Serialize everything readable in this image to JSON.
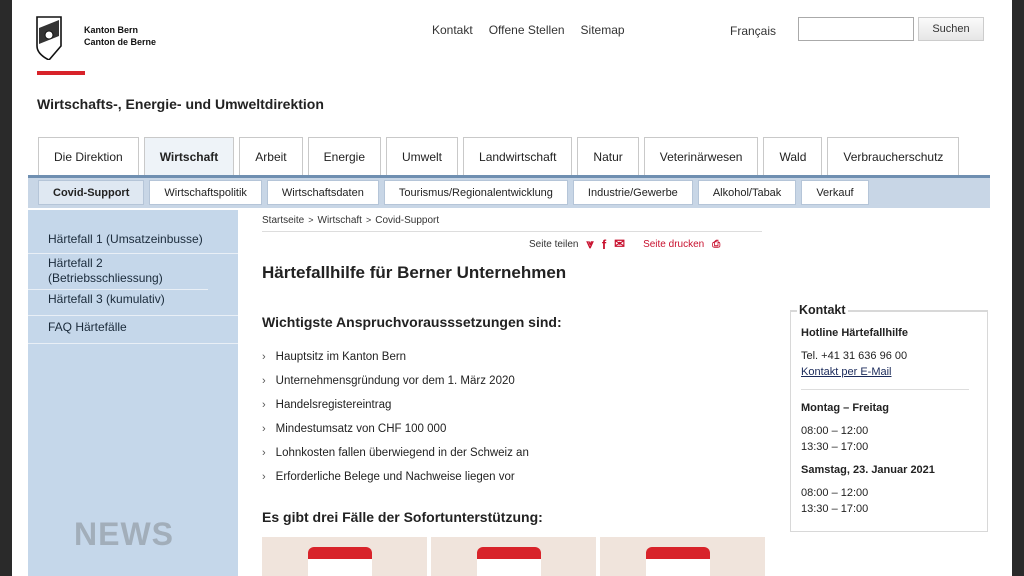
{
  "header": {
    "logo_line1": "Kanton Bern",
    "logo_line2": "Canton de Berne",
    "top_links": [
      "Kontakt",
      "Offene Stellen",
      "Sitemap"
    ],
    "language": "Français",
    "search_placeholder": "",
    "search_button": "Suchen"
  },
  "department_title": "Wirtschafts-, Energie- und Umweltdirektion",
  "main_tabs": [
    {
      "label": "Die Direktion",
      "active": false
    },
    {
      "label": "Wirtschaft",
      "active": true
    },
    {
      "label": "Arbeit",
      "active": false
    },
    {
      "label": "Energie",
      "active": false
    },
    {
      "label": "Umwelt",
      "active": false
    },
    {
      "label": "Landwirtschaft",
      "active": false
    },
    {
      "label": "Natur",
      "active": false
    },
    {
      "label": "Veterinärwesen",
      "active": false
    },
    {
      "label": "Wald",
      "active": false
    },
    {
      "label": "Verbraucherschutz",
      "active": false
    }
  ],
  "sub_tabs": [
    {
      "label": "Covid-Support",
      "active": true
    },
    {
      "label": "Wirtschaftspolitik",
      "active": false
    },
    {
      "label": "Wirtschaftsdaten",
      "active": false
    },
    {
      "label": "Tourismus/Regionalentwicklung",
      "active": false
    },
    {
      "label": "Industrie/Gewerbe",
      "active": false
    },
    {
      "label": "Alkohol/Tabak",
      "active": false
    },
    {
      "label": "Verkauf",
      "active": false
    }
  ],
  "sidebar": {
    "items": [
      "Härtefall 1 (Umsatzeinbusse)",
      "Härtefall 2 (Betriebsschliessung)",
      "Härtefall 3 (kumulativ)",
      "FAQ Härtefälle"
    ]
  },
  "breadcrumb": [
    "Startseite",
    "Wirtschaft",
    "Covid-Support"
  ],
  "share": {
    "label": "Seite teilen",
    "print": "Seite drucken"
  },
  "page_title": "Härtefallhilfe für Berner Unternehmen",
  "requirements": {
    "heading": "Wichtigste Anspruchvorausssetzungen sind:",
    "items": [
      "Hauptsitz im Kanton Bern",
      "Unternehmensgründung vor dem 1. März 2020",
      "Handelsregistereintrag",
      "Mindestumsatz von CHF 100 000",
      "Lohnkosten fallen überwiegend in der Schweiz an",
      "Erforderliche Belege und Nachweise liegen vor"
    ]
  },
  "cases_heading": "Es gibt drei Fälle der Sofortunterstützung:",
  "contact": {
    "title": "Kontakt",
    "hotline": "Hotline Härtefallhilfe",
    "phone": "Tel. +41 31 636 96 00",
    "email_link": "Kontakt per E-Mail",
    "weekdays": "Montag – Freitag",
    "wd_am": "08:00 – 12:00",
    "wd_pm": "13:30 – 17:00",
    "saturday": "Samstag, 23. Januar 2021",
    "sat_am": "08:00 – 12:00",
    "sat_pm": "13:30 – 17:00"
  },
  "watermark": "NEWS",
  "colors": {
    "accent_red": "#d8232a",
    "sidebar_blue": "#c5d7ea",
    "tab_line": "#6f8fb1"
  }
}
